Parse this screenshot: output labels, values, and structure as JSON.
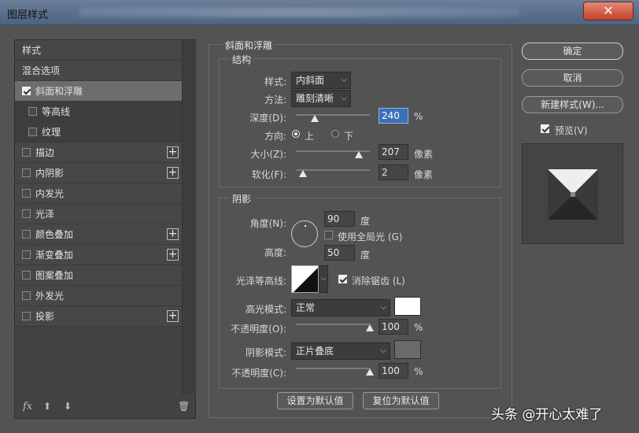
{
  "window": {
    "title": "图层样式",
    "close_label": "✕"
  },
  "styles_list": {
    "header": "样式",
    "items": [
      {
        "label": "混合选项",
        "checkbox": false,
        "plus": false
      },
      {
        "label": "斜面和浮雕",
        "checkbox": true,
        "checked": true,
        "plus": false,
        "selected": true
      },
      {
        "label": "等高线",
        "checkbox": true,
        "checked": false,
        "plus": false,
        "sub": true
      },
      {
        "label": "纹理",
        "checkbox": true,
        "checked": false,
        "plus": false,
        "sub": true
      },
      {
        "label": "描边",
        "checkbox": true,
        "checked": false,
        "plus": true
      },
      {
        "label": "内阴影",
        "checkbox": true,
        "checked": false,
        "plus": true
      },
      {
        "label": "内发光",
        "checkbox": true,
        "checked": false,
        "plus": false
      },
      {
        "label": "光泽",
        "checkbox": true,
        "checked": false,
        "plus": false
      },
      {
        "label": "颜色叠加",
        "checkbox": true,
        "checked": false,
        "plus": true
      },
      {
        "label": "渐变叠加",
        "checkbox": true,
        "checked": false,
        "plus": true
      },
      {
        "label": "图案叠加",
        "checkbox": true,
        "checked": false,
        "plus": false
      },
      {
        "label": "外发光",
        "checkbox": true,
        "checked": false,
        "plus": false
      },
      {
        "label": "投影",
        "checkbox": true,
        "checked": false,
        "plus": true
      }
    ],
    "bottom": {
      "fx": "fx",
      "up": "⬆",
      "down": "⬇",
      "trash": "🗑"
    }
  },
  "bevel": {
    "group_title": "斜面和浮雕",
    "structure": {
      "title": "结构",
      "style_label": "样式:",
      "style_value": "内斜面",
      "technique_label": "方法:",
      "technique_value": "雕刻清晰",
      "depth_label": "深度(D):",
      "depth_value": "240",
      "depth_unit": "%",
      "depth_slider": 0.25,
      "direction_label": "方向:",
      "direction_up": "上",
      "direction_down": "下",
      "size_label": "大小(Z):",
      "size_value": "207",
      "size_unit": "像素",
      "size_slider": 0.85,
      "soften_label": "软化(F):",
      "soften_value": "2",
      "soften_unit": "像素",
      "soften_slider": 0.1
    },
    "shading": {
      "title": "阴影",
      "angle_label": "角度(N):",
      "angle_value": "90",
      "angle_unit": "度",
      "global_light_label": "使用全局光 (G)",
      "altitude_label": "高度:",
      "altitude_value": "50",
      "altitude_unit": "度",
      "gloss_contour_label": "光泽等高线:",
      "anti_alias_label": "消除锯齿 (L)",
      "highlight_mode_label": "高光模式:",
      "highlight_mode_value": "正常",
      "highlight_color": "#ffffff",
      "highlight_opacity_label": "不透明度(O):",
      "highlight_opacity_value": "100",
      "highlight_opacity_unit": "%",
      "highlight_opacity_slider": 1.0,
      "shadow_mode_label": "阴影模式:",
      "shadow_mode_value": "正片叠底",
      "shadow_color": "#6a6a6a",
      "shadow_opacity_label": "不透明度(C):",
      "shadow_opacity_value": "100",
      "shadow_opacity_unit": "%",
      "shadow_opacity_slider": 1.0
    },
    "make_default": "设置为默认值",
    "reset_default": "复位为默认值"
  },
  "actions": {
    "ok": "确定",
    "cancel": "取消",
    "new_style": "新建样式(W)...",
    "preview_label": "预览(V)"
  },
  "watermark": "头条 @开心太难了"
}
